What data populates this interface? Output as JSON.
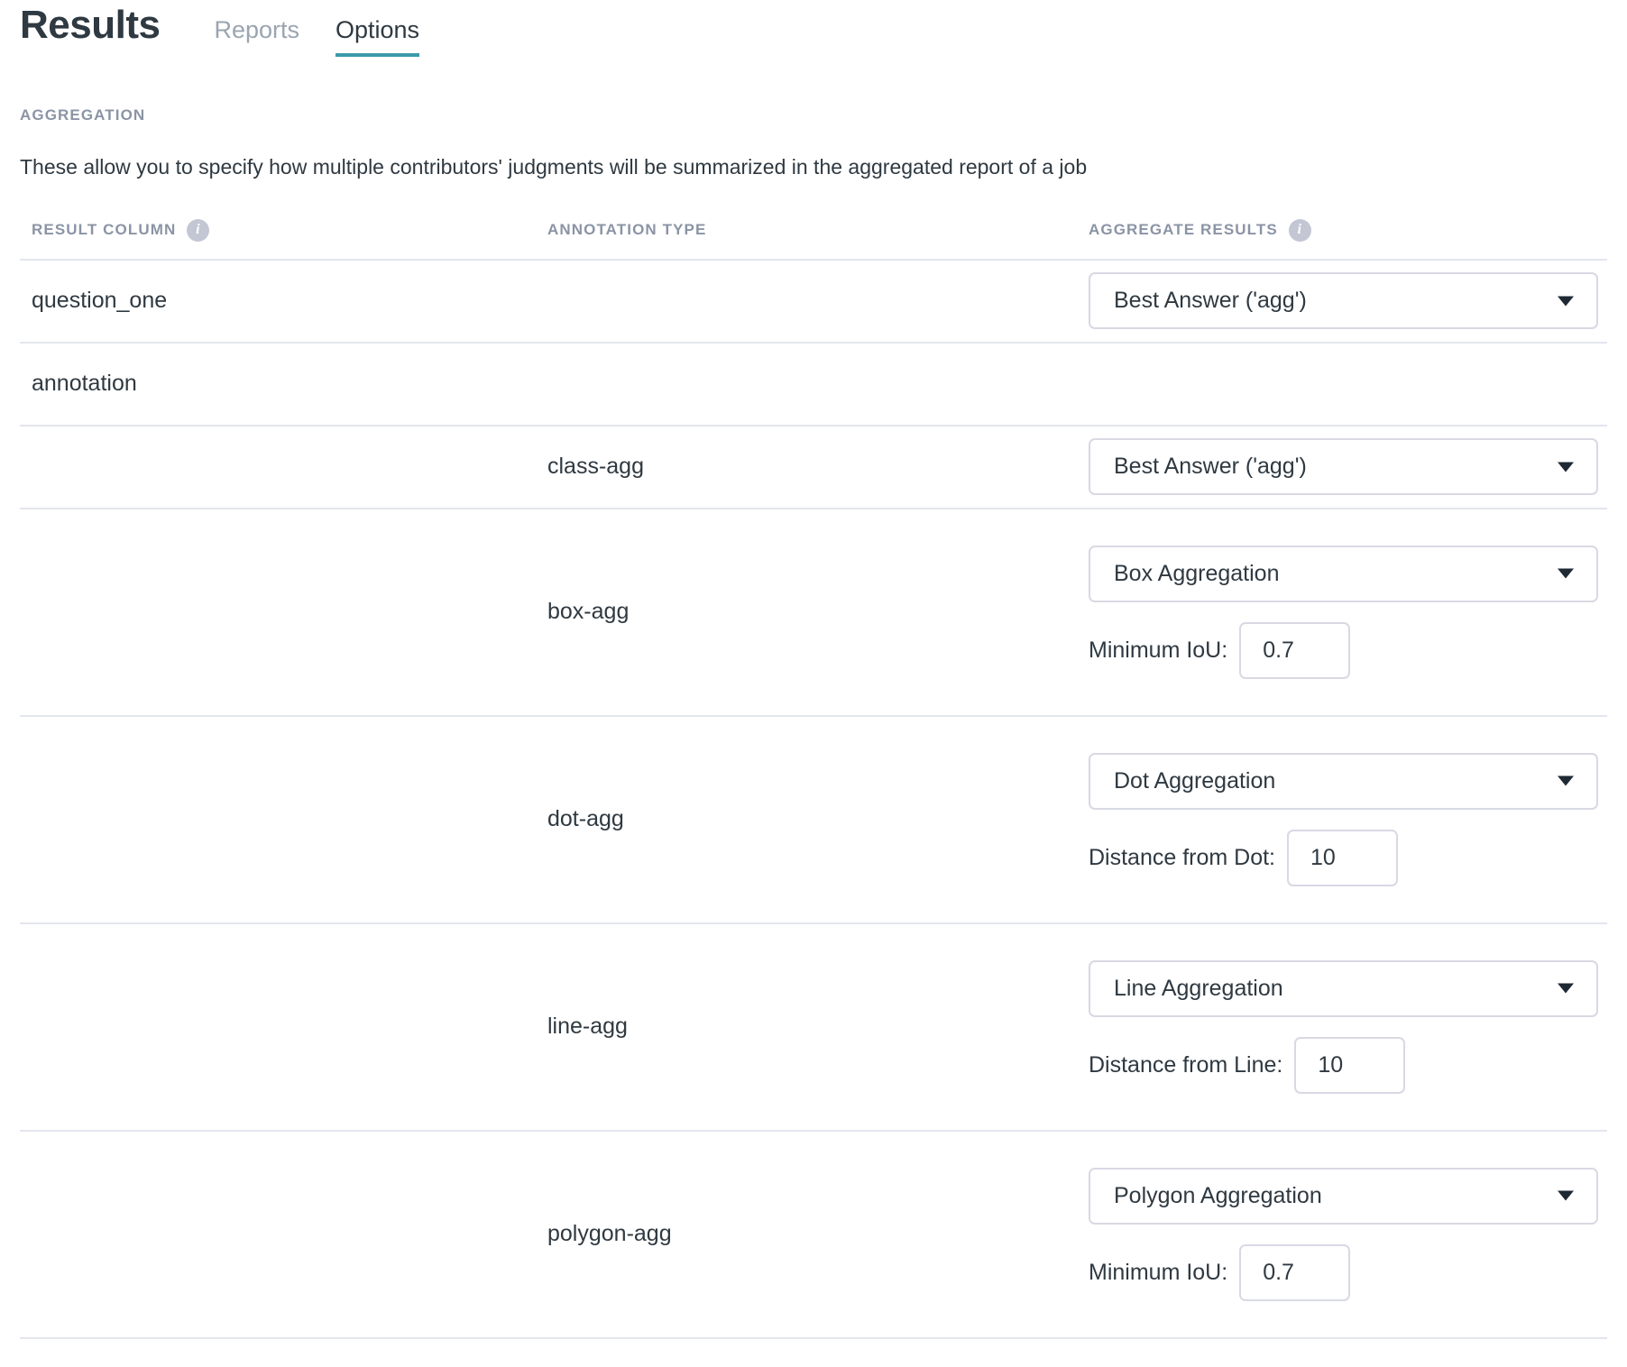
{
  "header": {
    "title": "Results",
    "tabs": [
      {
        "label": "Reports",
        "active": false
      },
      {
        "label": "Options",
        "active": true
      }
    ],
    "accent_color": "#3d9aa8"
  },
  "section": {
    "label": "AGGREGATION",
    "description": "These allow you to specify how multiple contributors' judgments will be summarized in the aggregated report of a job"
  },
  "table": {
    "columns": [
      {
        "label": "RESULT COLUMN",
        "info_icon": "info-icon"
      },
      {
        "label": "ANNOTATION TYPE",
        "info_icon": null
      },
      {
        "label": "AGGREGATE RESULTS",
        "info_icon": "info-icon"
      }
    ],
    "rows": [
      {
        "result_column": "question_one",
        "annotation_type": "",
        "aggregate": {
          "value": "Best Answer ('agg')",
          "caret_icon": "chevron-down-icon"
        },
        "param": null
      },
      {
        "result_column": "annotation",
        "annotation_type": "",
        "aggregate": null,
        "param": null
      },
      {
        "result_column": "",
        "annotation_type": "class-agg",
        "aggregate": {
          "value": "Best Answer ('agg')",
          "caret_icon": "chevron-down-icon"
        },
        "param": null
      },
      {
        "result_column": "",
        "annotation_type": "box-agg",
        "aggregate": {
          "value": "Box Aggregation",
          "caret_icon": "chevron-down-icon"
        },
        "param": {
          "label": "Minimum IoU:",
          "value": "0.7"
        }
      },
      {
        "result_column": "",
        "annotation_type": "dot-agg",
        "aggregate": {
          "value": "Dot Aggregation",
          "caret_icon": "chevron-down-icon"
        },
        "param": {
          "label": "Distance from Dot:",
          "value": "10"
        }
      },
      {
        "result_column": "",
        "annotation_type": "line-agg",
        "aggregate": {
          "value": "Line Aggregation",
          "caret_icon": "chevron-down-icon"
        },
        "param": {
          "label": "Distance from Line:",
          "value": "10"
        }
      },
      {
        "result_column": "",
        "annotation_type": "polygon-agg",
        "aggregate": {
          "value": "Polygon Aggregation",
          "caret_icon": "chevron-down-icon"
        },
        "param": {
          "label": "Minimum IoU:",
          "value": "0.7"
        }
      }
    ]
  }
}
